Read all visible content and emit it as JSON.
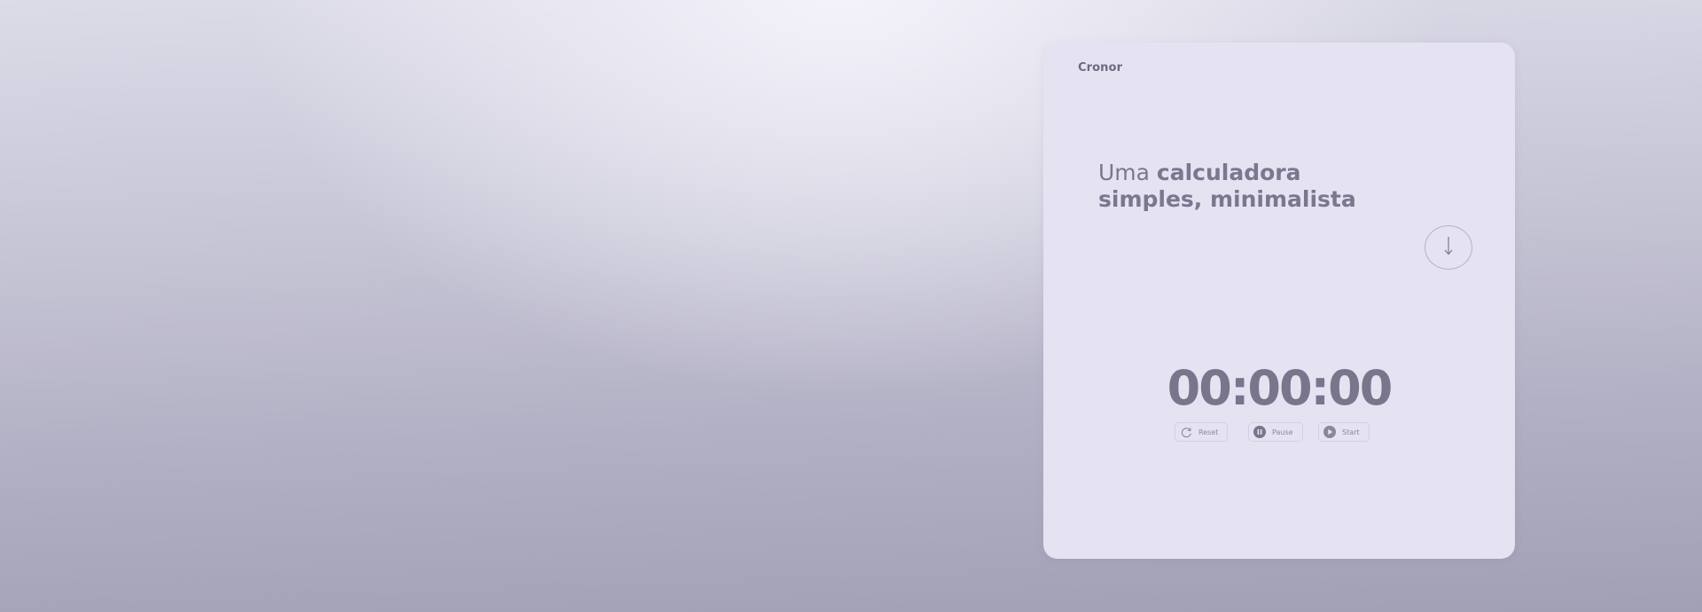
{
  "app": {
    "brand": "Cronor"
  },
  "hero": {
    "headline_light": "Uma ",
    "headline_bold_1": "calculadora",
    "headline_bold_2": "simples, minimalista",
    "scroll_icon": "arrow-down-icon"
  },
  "timer": {
    "display": "00:00:00"
  },
  "controls": {
    "reset_label": "Reset",
    "reset_icon": "reset-icon",
    "pause_label": "Pause",
    "pause_icon": "pause-icon",
    "start_label": "Start",
    "start_icon": "play-icon"
  },
  "colors": {
    "card_background": "#e5e3f2",
    "text_primary": "#78758c",
    "text_muted": "#8a879c",
    "border": "#d3d0e0"
  }
}
